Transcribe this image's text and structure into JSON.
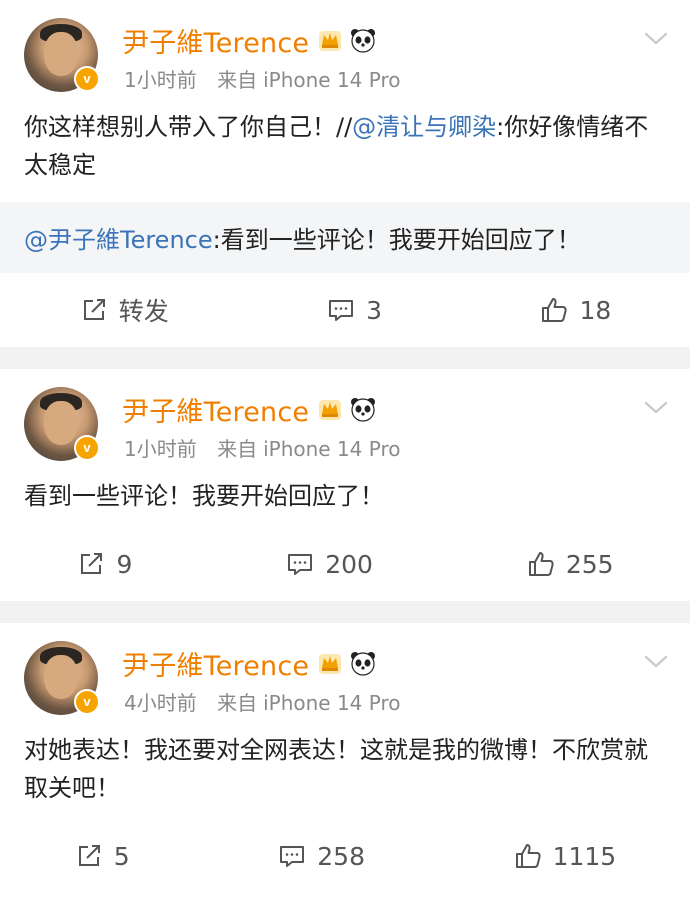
{
  "posts": [
    {
      "username": "尹子維Terence",
      "time": "1小时前",
      "source_prefix": "来自",
      "device": "iPhone 14 Pro",
      "body_text": "你这样想别人带入了你自己！//",
      "body_mention": "@清让与卿染",
      "body_after": ":你好像情绪不太稳定",
      "repost_mention": "@尹子維Terence",
      "repost_text": ":看到一些评论！我要开始回应了！",
      "repost_label": "转发",
      "comments": "3",
      "likes": "18"
    },
    {
      "username": "尹子維Terence",
      "time": "1小时前",
      "source_prefix": "来自",
      "device": "iPhone 14 Pro",
      "body_text": "看到一些评论！我要开始回应了！",
      "reposts": "9",
      "comments": "200",
      "likes": "255"
    },
    {
      "username": "尹子維Terence",
      "time": "4小时前",
      "source_prefix": "来自",
      "device": "iPhone 14 Pro",
      "body_text": "对她表达！我还要对全网表达！这就是我的微博！不欣赏就取关吧！",
      "reposts": "5",
      "comments": "258",
      "likes": "1115"
    }
  ],
  "colors": {
    "username": "#f07f00",
    "mention": "#3b74b8",
    "meta": "#8a8a8a",
    "separator": "#f2f2f2",
    "repost_bg": "#f4f5f7",
    "verified_badge": "#f7a300"
  },
  "icons": {
    "repost": "repost-icon",
    "comment": "comment-icon",
    "like": "like-icon",
    "more": "chevron-down-icon",
    "crown": "crown-icon",
    "panda": "panda-icon"
  }
}
